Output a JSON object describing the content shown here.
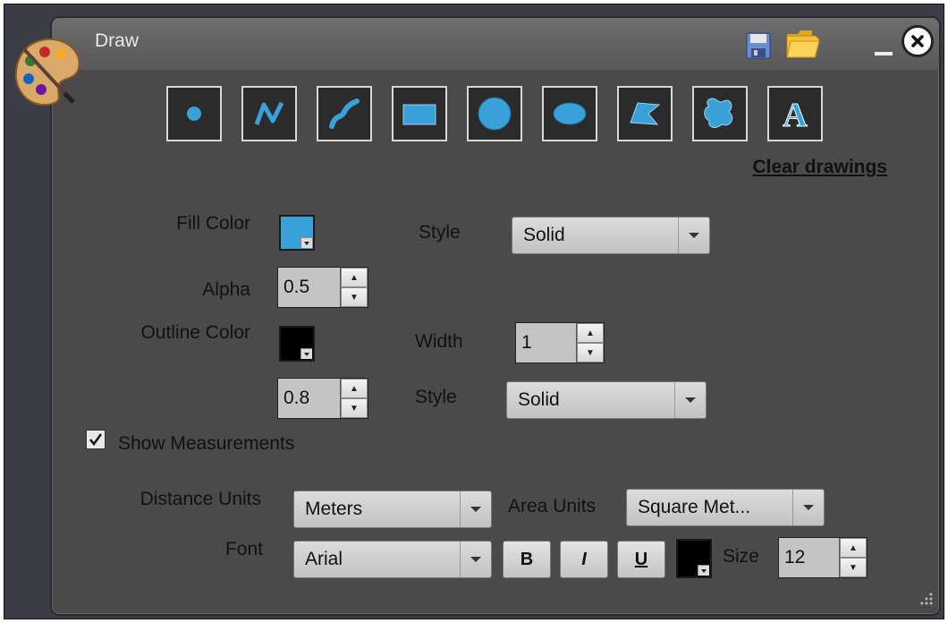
{
  "window": {
    "title": "Draw"
  },
  "toolbar": {
    "tools": [
      {
        "name": "point-tool",
        "icon": "point-icon"
      },
      {
        "name": "polyline-tool",
        "icon": "polyline-icon"
      },
      {
        "name": "freehand-line-tool",
        "icon": "freehand-line-icon"
      },
      {
        "name": "rectangle-tool",
        "icon": "rectangle-icon"
      },
      {
        "name": "circle-tool",
        "icon": "circle-icon"
      },
      {
        "name": "ellipse-tool",
        "icon": "ellipse-icon"
      },
      {
        "name": "polygon-tool",
        "icon": "polygon-icon"
      },
      {
        "name": "freehand-polygon-tool",
        "icon": "freehand-polygon-icon"
      },
      {
        "name": "text-tool",
        "icon": "text-icon",
        "glyph": "A"
      }
    ],
    "clear_label": "Clear drawings"
  },
  "fill": {
    "color_label": "Fill Color",
    "color": "#3aa0d8",
    "style_label": "Style",
    "style_value": "Solid",
    "alpha_label": "Alpha",
    "alpha_value": "0.5"
  },
  "outline": {
    "color_label": "Outline Color",
    "color": "#000000",
    "width_label": "Width",
    "width_value": "1",
    "alpha_value": "0.8",
    "style_label": "Style",
    "style_value": "Solid"
  },
  "measurements": {
    "checkbox_label": "Show Measurements",
    "checked": true,
    "distance_label": "Distance Units",
    "distance_value": "Meters",
    "area_label": "Area Units",
    "area_value": "Square Met..."
  },
  "font": {
    "label": "Font",
    "family_value": "Arial",
    "bold_label": "B",
    "italic_label": "I",
    "underline_label": "U",
    "color": "#000000",
    "size_label": "Size",
    "size_value": "12"
  },
  "colors": {
    "accent": "#3aa0d8",
    "panel": "#4a4a4a",
    "titlebar": "#5e5e5e"
  }
}
